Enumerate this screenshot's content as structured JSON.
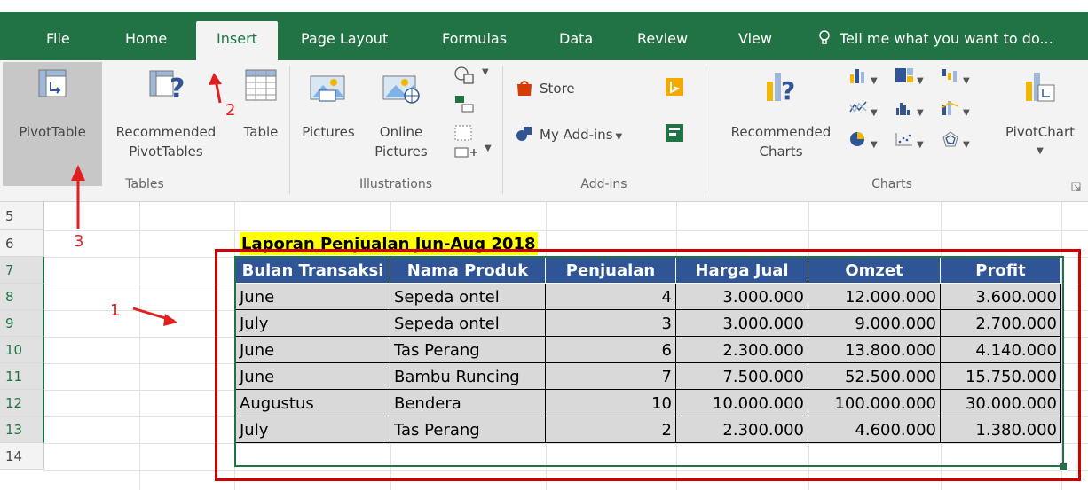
{
  "ribbon_tabs": {
    "file": "File",
    "home": "Home",
    "insert": "Insert",
    "page_layout": "Page Layout",
    "formulas": "Formulas",
    "data": "Data",
    "review": "Review",
    "view": "View"
  },
  "tell_me": "Tell me what you want to do...",
  "active_tab": "Insert",
  "ribbon": {
    "pivottable": "PivotTable",
    "recommended_pivottables_1": "Recommended",
    "recommended_pivottables_2": "PivotTables",
    "table": "Table",
    "pictures": "Pictures",
    "online_pictures_1": "Online",
    "online_pictures_2": "Pictures",
    "store": "Store",
    "my_addins": "My Add-ins",
    "recommended_charts_1": "Recommended",
    "recommended_charts_2": "Charts",
    "pivotchart": "PivotChart",
    "groups": {
      "tables": "Tables",
      "illustrations": "Illustrations",
      "addins": "Add-ins",
      "charts": "Charts"
    }
  },
  "row_numbers": [
    "5",
    "6",
    "7",
    "8",
    "9",
    "10",
    "11",
    "12",
    "13",
    "14"
  ],
  "sheet_title": "Laporan Penjualan Jun-Aug 2018",
  "table": {
    "headers": [
      "Bulan Transaksi",
      "Nama Produk",
      "Penjualan",
      "Harga Jual",
      "Omzet",
      "Profit"
    ],
    "rows": [
      [
        "June",
        "Sepeda ontel",
        "4",
        "3.000.000",
        "12.000.000",
        "3.600.000"
      ],
      [
        "July",
        "Sepeda ontel",
        "3",
        "3.000.000",
        "9.000.000",
        "2.700.000"
      ],
      [
        "June",
        "Tas Perang",
        "6",
        "2.300.000",
        "13.800.000",
        "4.140.000"
      ],
      [
        "June",
        "Bambu Runcing",
        "7",
        "7.500.000",
        "52.500.000",
        "15.750.000"
      ],
      [
        "Augustus",
        "Bendera",
        "10",
        "10.000.000",
        "100.000.000",
        "30.000.000"
      ],
      [
        "July",
        "Tas Perang",
        "2",
        "2.300.000",
        "4.600.000",
        "1.380.000"
      ]
    ]
  },
  "annotations": {
    "one": "1",
    "two": "2",
    "three": "3"
  },
  "colors": {
    "excel_green": "#217346",
    "header_blue": "#2f5597",
    "cell_gray": "#d9d9d9",
    "title_yellow": "#ffff00",
    "annotation_red": "#d00000"
  }
}
